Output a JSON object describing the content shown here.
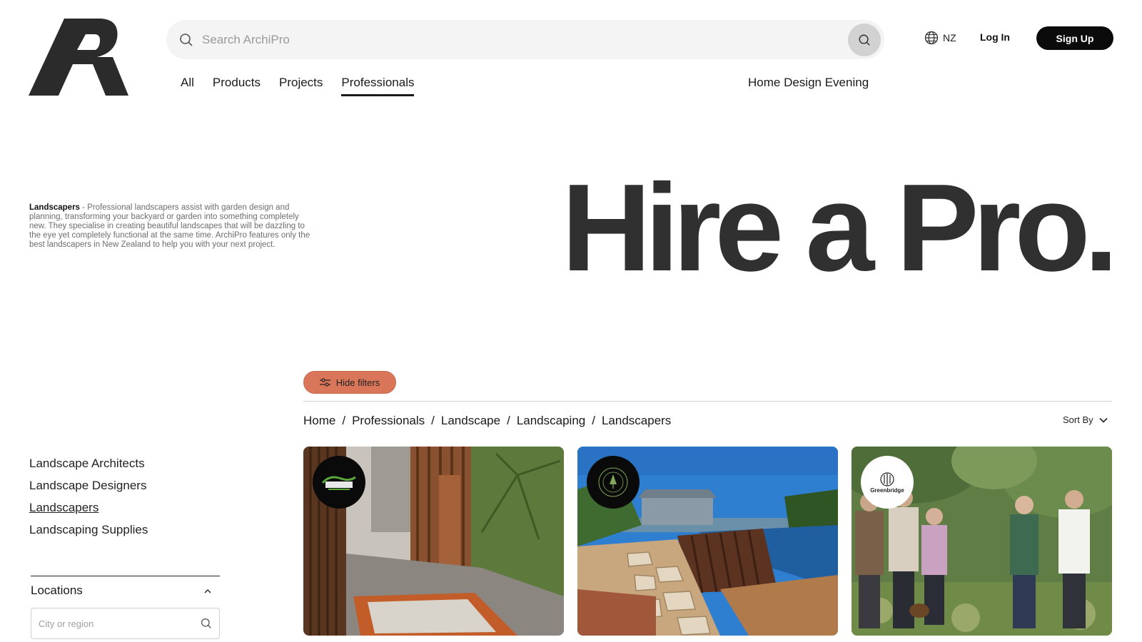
{
  "header": {
    "logo_icon": "archipro-logo",
    "search": {
      "placeholder": "Search ArchiPro"
    },
    "region": {
      "icon": "globe-icon",
      "label": "NZ"
    },
    "login_label": "Log In",
    "signup_label": "Sign Up"
  },
  "nav": {
    "items": [
      {
        "label": "All"
      },
      {
        "label": "Products"
      },
      {
        "label": "Projects"
      },
      {
        "label": "Professionals",
        "active": true
      }
    ],
    "event_label": "Home Design Evening"
  },
  "intro": {
    "term": "Landscapers",
    "text": " - Professional landscapers assist with garden design and planning, transforming your backyard or garden into something completely new. They specialise in creating beautiful landscapes that will be dazzling to the eye yet completely functional at the same time. ArchiPro features only the best landscapers in New Zealand to help you with your next project."
  },
  "hero": {
    "title": "Hire a Pro."
  },
  "filters": {
    "hide_label": "Hide filters"
  },
  "breadcrumb": [
    "Home",
    "Professionals",
    "Landscape",
    "Landscaping",
    "Landscapers"
  ],
  "sort_label": "Sort By",
  "sidebar": {
    "categories": [
      {
        "label": "Landscape Architects"
      },
      {
        "label": "Landscape Designers"
      },
      {
        "label": "Landscapers",
        "active": true
      },
      {
        "label": "Landscaping Supplies"
      }
    ],
    "locations": {
      "title": "Locations",
      "placeholder": "City or region"
    }
  },
  "cards": [
    {
      "badge": "gecko-logo"
    },
    {
      "badge": "circular-emblem-logo"
    },
    {
      "badge": "greenbridge-logo",
      "badge_text": "Greenbridge"
    }
  ],
  "colors": {
    "accent": "#d9765a",
    "dark": "#0b0b0b",
    "hero_text": "#303030"
  }
}
